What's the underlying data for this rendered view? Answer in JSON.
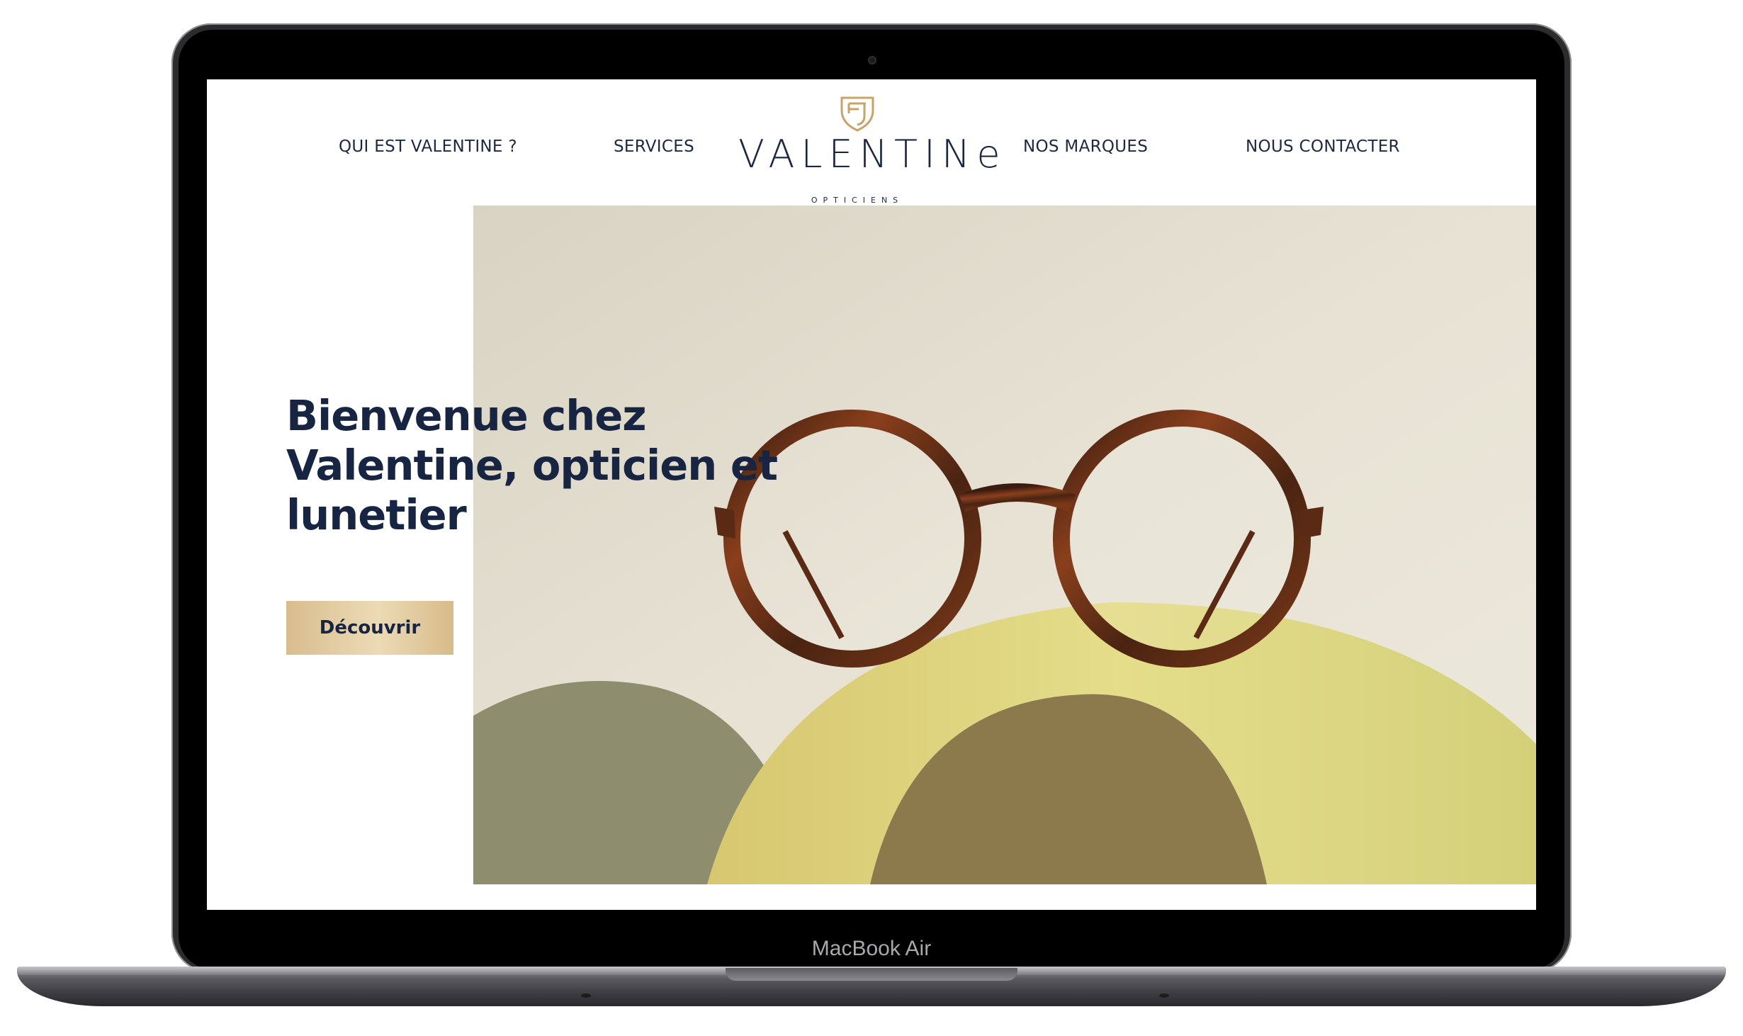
{
  "device": {
    "label": "MacBook Air"
  },
  "site": {
    "brand": {
      "name": "VALENTINe",
      "tagline": "OPTICIENS"
    },
    "nav": {
      "left": [
        "QUI EST VALENTINE ?",
        "SERVICES"
      ],
      "right": [
        "NOS MARQUES",
        "NOUS CONTACTER"
      ]
    },
    "hero": {
      "headline": "Bienvenue chez Valentine, opticien et lunetier",
      "cta_label": "Découvrir"
    }
  },
  "colors": {
    "navy": "#182542",
    "gold": "#d8bd8e",
    "backdrop": "#e6e0d2",
    "yellow_arch": "#d9d47a",
    "olive_arch": "#8e8d6d"
  }
}
